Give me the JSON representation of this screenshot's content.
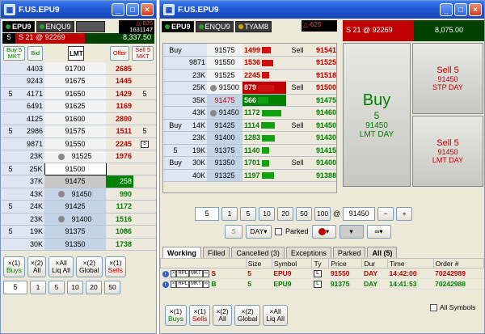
{
  "left": {
    "title": "F.US.EPU9",
    "tabs": [
      {
        "label": "EPU9"
      },
      {
        "label": "ENQU9"
      },
      {
        "label": ""
      }
    ],
    "alert": {
      "line1": "△-625",
      "line2": "1631147"
    },
    "position": {
      "qty": "5",
      "desc": "S 21 @ 92269",
      "pnl": "8,337.50"
    },
    "tools": {
      "buy_mkt": "Buy 5",
      "buy_mkt2": "MKT",
      "bid": "Bid",
      "lmt": "LMT",
      "offer": "Offer",
      "sell_mkt": "Sell 5",
      "sell_mkt2": "MKT"
    },
    "ladder": [
      {
        "b": "",
        "bv": "4403",
        "p": "91700",
        "sv": "2685",
        "s": ""
      },
      {
        "b": "",
        "bv": "9243",
        "p": "91675",
        "sv": "1445",
        "s": ""
      },
      {
        "b": "5",
        "bv": "4171",
        "p": "91650",
        "sv": "1429",
        "s": "5"
      },
      {
        "b": "",
        "bv": "6491",
        "p": "91625",
        "sv": "1169",
        "s": ""
      },
      {
        "b": "",
        "bv": "4125",
        "p": "91600",
        "sv": "2800",
        "s": ""
      },
      {
        "b": "5",
        "bv": "2986",
        "p": "91575",
        "sv": "1511",
        "s": "5"
      },
      {
        "b": "",
        "bv": "9871",
        "p": "91550",
        "sv": "2245",
        "s": "5"
      },
      {
        "b": "",
        "bv": "23K",
        "p": "91525",
        "sv": "1976",
        "s": ""
      },
      {
        "b": "5",
        "bv": "25K",
        "p": "91500",
        "sv": "",
        "s": ""
      },
      {
        "b": "",
        "bv": "37K",
        "p": "91475",
        "sv": "258",
        "s": ""
      },
      {
        "b": "",
        "bv": "43K",
        "p": "91450",
        "sv": "990",
        "s": ""
      },
      {
        "b": "5",
        "bv": "24K",
        "p": "91425",
        "sv": "1172",
        "s": ""
      },
      {
        "b": "",
        "bv": "23K",
        "p": "91400",
        "sv": "1516",
        "s": ""
      },
      {
        "b": "5",
        "bv": "19K",
        "p": "91375",
        "sv": "1086",
        "s": ""
      },
      {
        "b": "",
        "bv": "30K",
        "p": "91350",
        "sv": "1738",
        "s": ""
      }
    ],
    "cancel": [
      {
        "l1": "×(1)",
        "l2": "Buys"
      },
      {
        "l1": "×(2)",
        "l2": "All"
      },
      {
        "l1": "×All",
        "l2": "Liq All"
      },
      {
        "l1": "×(2)",
        "l2": "Global"
      },
      {
        "l1": "×(1)",
        "l2": "Sells"
      }
    ],
    "qty": {
      "value": "5",
      "presets": [
        "1",
        "5",
        "10",
        "20",
        "50"
      ]
    }
  },
  "right": {
    "title": "F.US.EPU9",
    "tabs": [
      {
        "label": "EPU9"
      },
      {
        "label": "ENQU9"
      },
      {
        "label": "TYAM8"
      }
    ],
    "alert": "△-625",
    "position": {
      "desc": "S 21 @ 92269",
      "pnl": "8,075.00"
    },
    "ladder": [
      {
        "b": "Buy",
        "bv": "",
        "p": "91575",
        "sv": "1499",
        "s": "Sell",
        "x": "91541"
      },
      {
        "b": "",
        "bv": "9871",
        "p": "91550",
        "sv": "1536",
        "s": "",
        "x": "91525"
      },
      {
        "b": "",
        "bv": "23K",
        "p": "91525",
        "sv": "2245",
        "s": "",
        "x": "91518"
      },
      {
        "b": "",
        "bv": "25K",
        "p": "91500",
        "sv": "879",
        "s": "Sell",
        "x": "91500"
      },
      {
        "b": "",
        "bv": "35K",
        "p": "91475",
        "sv": "566",
        "s": "",
        "x": "91475"
      },
      {
        "b": "",
        "bv": "43K",
        "p": "91450",
        "sv": "1172",
        "s": "",
        "x": "91460"
      },
      {
        "b": "Buy",
        "bv": "14K",
        "p": "91425",
        "sv": "1114",
        "s": "Sell",
        "x": "91450"
      },
      {
        "b": "",
        "bv": "23K",
        "p": "91400",
        "sv": "1283",
        "s": "",
        "x": "91430"
      },
      {
        "b": "5",
        "bv": "19K",
        "p": "91375",
        "sv": "1140",
        "s": "",
        "x": "91415"
      },
      {
        "b": "Buy",
        "bv": "30K",
        "p": "91350",
        "sv": "1701",
        "s": "Sell",
        "x": "91400"
      },
      {
        "b": "",
        "bv": "40K",
        "p": "91325",
        "sv": "1197",
        "s": "",
        "x": "91388"
      }
    ],
    "buy_big": {
      "l1": "Buy",
      "l2": "5",
      "l3": "91450",
      "l4": "LMT DAY"
    },
    "sell_stp": {
      "l1": "Sell 5",
      "l2": "91450",
      "l3": "STP DAY"
    },
    "sell_lmt": {
      "l1": "Sell 5",
      "l2": "91450",
      "l3": "LMT DAY"
    },
    "qty": {
      "value": "5",
      "presets": [
        "1",
        "5",
        "10",
        "20",
        "50",
        "100"
      ],
      "at": "@",
      "price": "91450",
      "minus": "−",
      "plus": "+"
    },
    "ordertype": {
      "s": "S",
      "day": "DAY",
      "parked": "Parked"
    },
    "order_tabs": [
      "Working",
      "Filled",
      "Cancelled (3)",
      "Exceptions",
      "Parked",
      "All (5)"
    ],
    "order_headers": [
      "",
      "Size",
      "Symbol",
      "Ty",
      "Price",
      "Dur",
      "Time",
      "Order #"
    ],
    "orders": [
      {
        "side": "S",
        "size": "5",
        "symbol": "EPU9",
        "price": "91550",
        "dur": "DAY",
        "time": "14:42:00",
        "num": "70242989"
      },
      {
        "side": "B",
        "size": "5",
        "symbol": "EPU9",
        "price": "91375",
        "dur": "DAY",
        "time": "14:41:53",
        "num": "70242988"
      }
    ],
    "bottom": [
      {
        "l1": "×(1)",
        "l2": "Buys"
      },
      {
        "l1": "×(1)",
        "l2": "Sells"
      },
      {
        "l1": "×(2)",
        "l2": "All"
      },
      {
        "l1": "×(2)",
        "l2": "Global"
      },
      {
        "l1": "×All",
        "l2": "Liq All"
      }
    ],
    "all_symbols": "All Symbols"
  },
  "colors": {
    "buy": "#008000",
    "sell": "#c00000",
    "title": "#2159d6"
  }
}
